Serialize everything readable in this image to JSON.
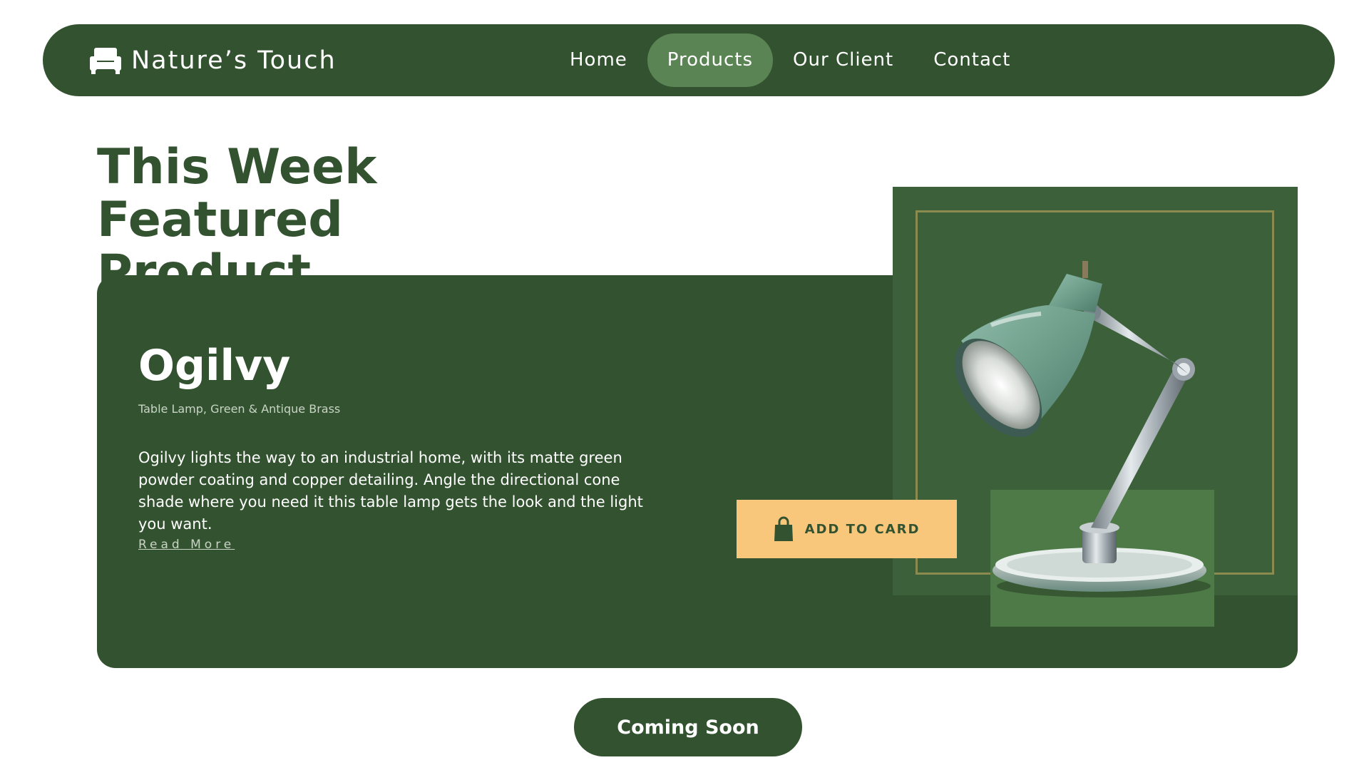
{
  "brand": {
    "name": "Nature’s Touch",
    "icon": "sofa-icon"
  },
  "nav": {
    "items": [
      {
        "label": "Home",
        "active": false
      },
      {
        "label": "Products",
        "active": true
      },
      {
        "label": "Our Client",
        "active": false
      },
      {
        "label": "Contact",
        "active": false
      }
    ]
  },
  "featured": {
    "heading_line1": "This Week Featured",
    "heading_line2": "Product"
  },
  "product": {
    "name": "Ogilvy",
    "subtitle": "Table Lamp, Green & Antique Brass",
    "description": "Ogilvy lights the way to an industrial home, with its matte green powder coating and copper detailing. Angle the directional cone shade where you need it this table lamp gets the look and the light you want.",
    "read_more": "Read More",
    "image_icon": "desk-lamp-image"
  },
  "add_button": {
    "label": "ADD TO CARD",
    "icon": "shopping-bag-icon"
  },
  "coming_soon": {
    "label": "Coming Soon"
  },
  "colors": {
    "primary": "#335330",
    "nav_active": "#5b8455",
    "image_panel": "#3c613a",
    "frame": "#8b8a4f",
    "accent": "#f9c77c",
    "base_box": "#4d7a47"
  }
}
